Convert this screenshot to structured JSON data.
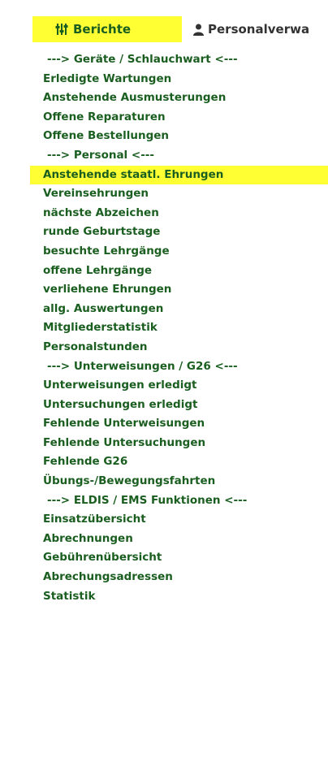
{
  "tabs": {
    "berichte": {
      "label": "Berichte",
      "icon": "sliders-icon"
    },
    "personal": {
      "label": "Personalverwa",
      "icon": "person-icon"
    }
  },
  "menu": {
    "items": [
      {
        "label": "---> Geräte / Schlauchwart <---",
        "type": "separator"
      },
      {
        "label": "Erledigte Wartungen",
        "type": "link"
      },
      {
        "label": "Anstehende Ausmusterungen",
        "type": "link"
      },
      {
        "label": "Offene Reparaturen",
        "type": "link"
      },
      {
        "label": "Offene Bestellungen",
        "type": "link"
      },
      {
        "label": "---> Personal <---",
        "type": "separator"
      },
      {
        "label": "Anstehende staatl. Ehrungen",
        "type": "link",
        "highlighted": true
      },
      {
        "label": "Vereinsehrungen",
        "type": "link"
      },
      {
        "label": "nächste Abzeichen",
        "type": "link"
      },
      {
        "label": "runde Geburtstage",
        "type": "link"
      },
      {
        "label": "besuchte Lehrgänge",
        "type": "link"
      },
      {
        "label": "offene Lehrgänge",
        "type": "link"
      },
      {
        "label": "verliehene Ehrungen",
        "type": "link"
      },
      {
        "label": "allg. Auswertungen",
        "type": "link"
      },
      {
        "label": "Mitgliederstatistik",
        "type": "link"
      },
      {
        "label": "Personalstunden",
        "type": "link"
      },
      {
        "label": "---> Unterweisungen / G26 <---",
        "type": "separator"
      },
      {
        "label": "Unterweisungen erledigt",
        "type": "link"
      },
      {
        "label": "Untersuchungen erledigt",
        "type": "link"
      },
      {
        "label": "Fehlende Unterweisungen",
        "type": "link"
      },
      {
        "label": "Fehlende Untersuchungen",
        "type": "link"
      },
      {
        "label": "Fehlende G26",
        "type": "link"
      },
      {
        "label": "Übungs-/Bewegungsfahrten",
        "type": "link"
      },
      {
        "label": "---> ELDIS / EMS Funktionen <---",
        "type": "separator"
      },
      {
        "label": "Einsatzübersicht",
        "type": "link"
      },
      {
        "label": "Abrechnungen",
        "type": "link"
      },
      {
        "label": "Gebührenübersicht",
        "type": "link"
      },
      {
        "label": "Abrechungsadressen",
        "type": "link"
      },
      {
        "label": "Statistik",
        "type": "link"
      }
    ]
  },
  "colors": {
    "link": "#1a5e20",
    "highlight": "#ffff33",
    "tab_inactive": "#333333"
  }
}
